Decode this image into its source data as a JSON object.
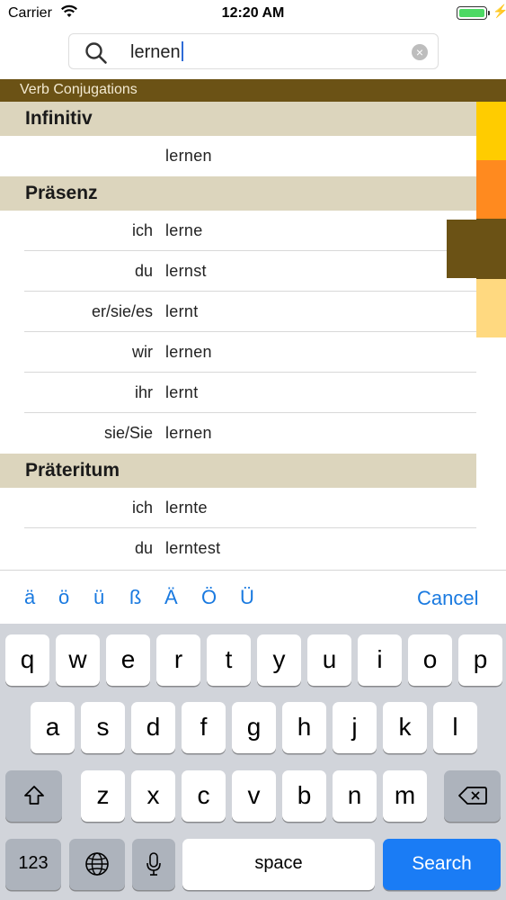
{
  "status_bar": {
    "carrier": "Carrier",
    "time": "12:20 AM",
    "battery_level": 1.0
  },
  "search": {
    "value": "lernen"
  },
  "header": {
    "title": "Verb Conjugations"
  },
  "sections": [
    {
      "title": "Infinitiv",
      "rows": [
        {
          "pronoun": "",
          "form": "lernen"
        }
      ]
    },
    {
      "title": "Präsenz",
      "rows": [
        {
          "pronoun": "ich",
          "form": "lerne"
        },
        {
          "pronoun": "du",
          "form": "lernst"
        },
        {
          "pronoun": "er/sie/es",
          "form": "lernt"
        },
        {
          "pronoun": "wir",
          "form": "lernen"
        },
        {
          "pronoun": "ihr",
          "form": "lernt"
        },
        {
          "pronoun": "sie/Sie",
          "form": "lernen"
        }
      ]
    },
    {
      "title": "Präteritum",
      "rows": [
        {
          "pronoun": "ich",
          "form": "lernte"
        },
        {
          "pronoun": "du",
          "form": "lerntest"
        }
      ]
    }
  ],
  "index_colors": [
    "#ffcc00",
    "#ff8a1f",
    "#6b5215",
    "#ffd980"
  ],
  "accent_bar": {
    "characters": [
      "ä",
      "ö",
      "ü",
      "ß",
      "Ä",
      "Ö",
      "Ü"
    ],
    "cancel_label": "Cancel"
  },
  "keyboard": {
    "row1": [
      "q",
      "w",
      "e",
      "r",
      "t",
      "y",
      "u",
      "i",
      "o",
      "p"
    ],
    "row2": [
      "a",
      "s",
      "d",
      "f",
      "g",
      "h",
      "j",
      "k",
      "l"
    ],
    "row3": [
      "z",
      "x",
      "c",
      "v",
      "b",
      "n",
      "m"
    ],
    "numbers_label": "123",
    "space_label": "space",
    "search_label": "Search"
  },
  "colors": {
    "header_bg": "#6b5215",
    "section_bg": "#dcd5bd",
    "accent_blue": "#1a7ae0",
    "search_key": "#1a7cf5"
  }
}
